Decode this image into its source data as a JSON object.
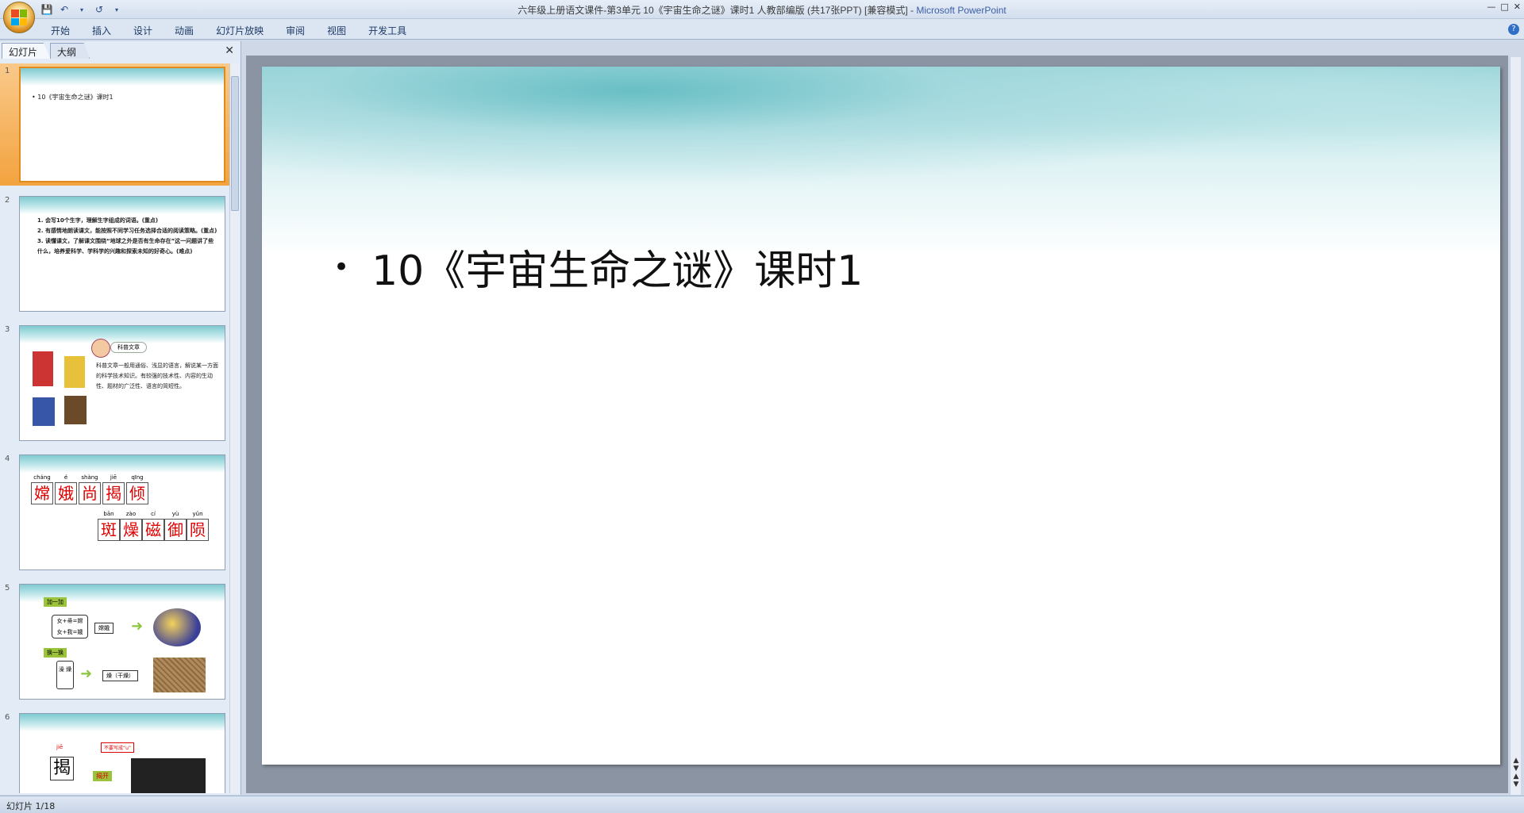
{
  "window": {
    "title": "六年级上册语文课件-第3单元 10《宇宙生命之谜》课时1  人教部编版 (共17张PPT) [兼容模式] - ",
    "app_name": "Microsoft PowerPoint"
  },
  "ribbon": {
    "tabs": [
      "开始",
      "插入",
      "设计",
      "动画",
      "幻灯片放映",
      "审阅",
      "视图",
      "开发工具"
    ]
  },
  "left_pane": {
    "tabs": [
      "幻灯片",
      "大纲"
    ]
  },
  "thumbnails": [
    {
      "num": "1",
      "text": "• 10《宇宙生命之谜》课时1"
    },
    {
      "num": "2",
      "lines": [
        "1. 会写10个生字，理解生字组成的词语。(重点)",
        "2. 有感情地朗读课文，能按照不同学习任务选择合适的阅读策略。(重点)",
        "3. 读懂课文，了解课文围绕“地球之外是否有生命存在”这一问题讲了些什么，培养爱科学、学科学的兴趣和探索未知的好奇心。(难点)"
      ]
    },
    {
      "num": "3",
      "label": "科普文章",
      "body": "科普文章一般用通俗、浅显的语言，解说某一方面的科学技术知识。有较强的技术性、内容的生动性、题材的广泛性、语言的简短性。"
    },
    {
      "num": "4",
      "pinyin1": [
        "cháng",
        "é",
        "shàng",
        "jiē",
        "qīng"
      ],
      "chars1": [
        "嫦",
        "娥",
        "尚",
        "揭",
        "倾"
      ],
      "pinyin2": [
        "bān",
        "zào",
        "cí",
        "yù",
        "yǔn"
      ],
      "chars2": [
        "斑",
        "燥",
        "磁",
        "御",
        "陨"
      ]
    },
    {
      "num": "5",
      "tag1": "加一加",
      "box1a": "女+帚=嫦",
      "box1b": "女+我=娥",
      "word1": "嫦娥",
      "tag2": "换一换",
      "box2": "澡 燥",
      "word2": "燥（干燥）"
    },
    {
      "num": "6",
      "pinyin": "jiē",
      "char": "揭",
      "note": "不要写成“u”",
      "word": "揭开"
    }
  ],
  "slide": {
    "bullet_text": "10《宇宙生命之谜》课时1"
  },
  "status": {
    "text": "幻灯片 1/18"
  }
}
